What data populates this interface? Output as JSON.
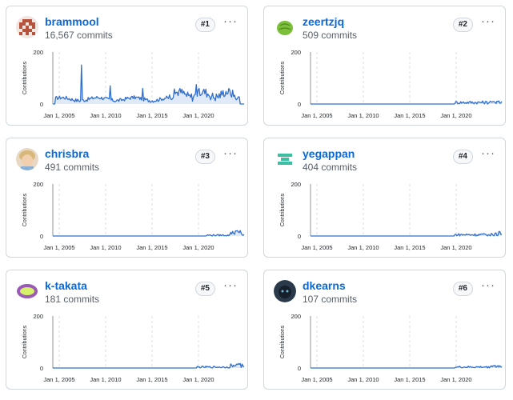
{
  "contributors": [
    {
      "rank": "#1",
      "username": "brammool",
      "commits": "16,567 commits",
      "avatar_icon": "pixel-avatar-red",
      "accent": "#b5533c",
      "variant": "big"
    },
    {
      "rank": "#2",
      "username": "zeertzjq",
      "commits": "509 commits",
      "avatar_icon": "green-leaf-avatar",
      "accent": "#7bbf3a",
      "variant": "z"
    },
    {
      "rank": "#3",
      "username": "chrisbra",
      "commits": "491 commits",
      "avatar_icon": "child-photo-avatar",
      "accent": "#c9a27a",
      "variant": "c"
    },
    {
      "rank": "#4",
      "username": "yegappan",
      "commits": "404 commits",
      "avatar_icon": "teal-identicon-avatar",
      "accent": "#3bbfa0",
      "variant": "y"
    },
    {
      "rank": "#5",
      "username": "k-takata",
      "commits": "181 commits",
      "avatar_icon": "purple-badge-avatar",
      "accent": "#9b59b6",
      "variant": "k"
    },
    {
      "rank": "#6",
      "username": "dkearns",
      "commits": "107 commits",
      "avatar_icon": "cat-photo-avatar",
      "accent": "#2b3a4a",
      "variant": "d"
    }
  ],
  "axis": {
    "ylabel": "Contributions",
    "yticks": [
      "200",
      "0"
    ],
    "xticks": [
      "Jan 1, 2005",
      "Jan 1, 2010",
      "Jan 1, 2015",
      "Jan 1, 2020"
    ]
  },
  "colors": {
    "line": "#2e6fd0",
    "fill": "#dfe9f7",
    "grid": "#d8dee4"
  }
}
